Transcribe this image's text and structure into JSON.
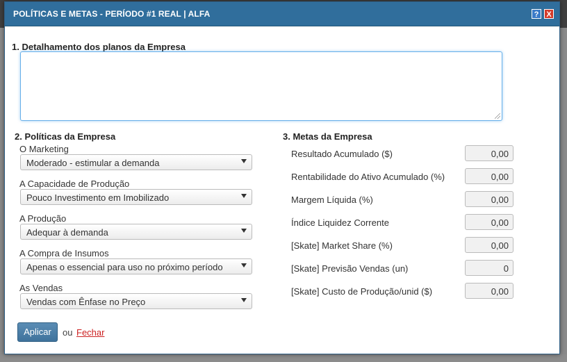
{
  "modal": {
    "title": "POLÍTICAS E METAS - PERÍODO #1 REAL | ALFA",
    "help_label": "?",
    "close_label": "X"
  },
  "section1": {
    "title": "1. Detalhamento dos planos da Empresa",
    "textarea_value": ""
  },
  "section2": {
    "title": "2. Políticas da Empresa",
    "fields": [
      {
        "label": "O Marketing",
        "value": "Moderado - estimular a demanda"
      },
      {
        "label": "A Capacidade de Produção",
        "value": "Pouco Investimento em Imobilizado"
      },
      {
        "label": "A Produção",
        "value": "Adequar à demanda"
      },
      {
        "label": "A Compra de Insumos",
        "value": "Apenas o essencial para uso no próximo período"
      },
      {
        "label": "As Vendas",
        "value": "Vendas com Ênfase no Preço"
      }
    ]
  },
  "section3": {
    "title": "3. Metas da Empresa",
    "rows": [
      {
        "label": "Resultado Acumulado ($)",
        "value": "0,00"
      },
      {
        "label": "Rentabilidade do Ativo Acumulado (%)",
        "value": "0,00"
      },
      {
        "label": "Margem Líquida (%)",
        "value": "0,00"
      },
      {
        "label": "Índice Liquidez Corrente",
        "value": "0,00"
      },
      {
        "label": "[Skate] Market Share (%)",
        "value": "0,00"
      },
      {
        "label": "[Skate] Previsão Vendas (un)",
        "value": "0"
      },
      {
        "label": "[Skate] Custo de Produção/unid ($)",
        "value": "0,00"
      }
    ]
  },
  "footer": {
    "apply_label": "Aplicar",
    "or_text": "ou",
    "close_link": "Fechar"
  },
  "colors": {
    "titlebar": "#306e9c",
    "apply_button": "#4a7ea8",
    "close_link": "#cc2222"
  }
}
